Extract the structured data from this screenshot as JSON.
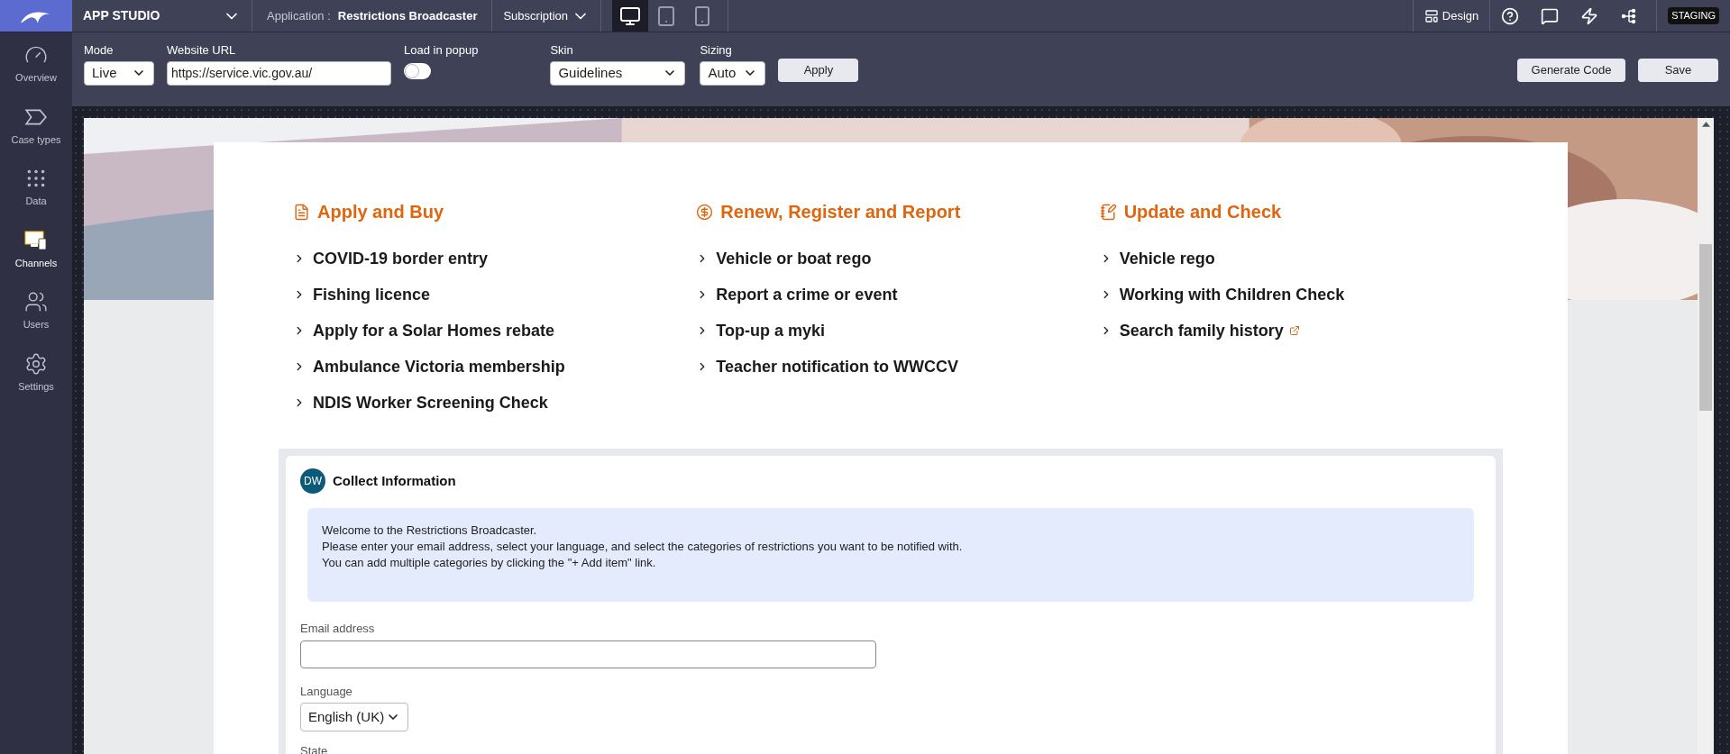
{
  "app_bar": {
    "studio": "APP STUDIO",
    "application_label": "Application :",
    "application_name": "Restrictions Broadcaster",
    "subscription": "Subscription",
    "devices": [
      {
        "kind": "desktop",
        "selected": true
      },
      {
        "kind": "tablet",
        "selected": false
      },
      {
        "kind": "phone",
        "selected": false
      }
    ],
    "design": "Design",
    "environment": "STAGING"
  },
  "sidebar": {
    "items": [
      {
        "label": "Overview",
        "selected": false
      },
      {
        "label": "Case types",
        "selected": false
      },
      {
        "label": "Data",
        "selected": false
      },
      {
        "label": "Channels",
        "selected": true
      },
      {
        "label": "Users",
        "selected": false
      },
      {
        "label": "Settings",
        "selected": false
      }
    ]
  },
  "toolbar": {
    "mode": {
      "label": "Mode",
      "value": "Live"
    },
    "url": {
      "label": "Website URL",
      "value": "https://service.vic.gov.au/"
    },
    "popup": {
      "label": "Load in popup",
      "on": false
    },
    "skin": {
      "label": "Skin",
      "value": "Guidelines"
    },
    "sizing": {
      "label": "Sizing",
      "value": "Auto"
    },
    "apply": "Apply",
    "generate": "Generate Code",
    "save": "Save"
  },
  "page": {
    "sections": [
      {
        "title": "Apply and Buy",
        "links": [
          {
            "label": "COVID-19 border entry",
            "external": false
          },
          {
            "label": "Fishing licence",
            "external": false
          },
          {
            "label": "Apply for a Solar Homes rebate",
            "external": false
          },
          {
            "label": "Ambulance Victoria membership",
            "external": false
          },
          {
            "label": "NDIS Worker Screening Check",
            "external": false
          }
        ]
      },
      {
        "title": "Renew, Register and Report",
        "links": [
          {
            "label": "Vehicle or boat rego",
            "external": false
          },
          {
            "label": "Report a crime or event",
            "external": false
          },
          {
            "label": "Top-up a myki",
            "external": false
          },
          {
            "label": "Teacher notification to WWCCV",
            "external": false
          }
        ]
      },
      {
        "title": "Update and Check",
        "links": [
          {
            "label": "Vehicle rego",
            "external": false
          },
          {
            "label": "Working with Children Check",
            "external": false
          },
          {
            "label": "Search family history",
            "external": true
          }
        ]
      }
    ],
    "form": {
      "avatar": "DW",
      "title": "Collect Information",
      "note": [
        "Welcome to the Restrictions Broadcaster.",
        "Please enter your email address, select your language, and select the categories of restrictions you want to be notified with.",
        "You can add multiple categories by clicking the \"+ Add item\" link."
      ],
      "email": {
        "label": "Email address"
      },
      "language": {
        "label": "Language",
        "value": "English (UK)"
      },
      "state": {
        "label": "State"
      }
    }
  }
}
